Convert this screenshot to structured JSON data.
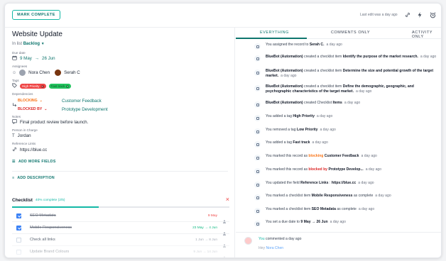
{
  "topbar": {
    "mark_complete_label": "MARK COMPLETE",
    "last_edited": "Last edit was a day ago",
    "icons": [
      "link-icon",
      "bolt-icon",
      "alarm-icon"
    ]
  },
  "record": {
    "title": "Website Update",
    "in_list_prefix": "In list",
    "list_name": "Backlog",
    "due_label": "Due date",
    "due_start": "9 May",
    "due_arrow": "→",
    "due_end": "26 Jun",
    "assignees_label": "Assignees",
    "assignees": [
      {
        "name": "Nora Chen"
      },
      {
        "name": "Serah C"
      }
    ],
    "tags_label": "Tags",
    "tags": [
      {
        "label": "High Priority",
        "color": "#ef4444"
      },
      {
        "label": "Fast track",
        "color": "#22c55e",
        "text_color": "#14532d"
      }
    ],
    "dependencies_label": "Dependencies",
    "dependencies": [
      {
        "kind": "BLOCKING",
        "color": "#f97316",
        "target": "Customer Feedback"
      },
      {
        "kind": "BLOCKED BY",
        "color": "#dc2626",
        "target": "Prototype Development"
      }
    ],
    "notes_label": "Notes",
    "notes": "Final product review before launch.",
    "person_label": "Person in Charge",
    "person": "Jordan",
    "reference_label": "Reference Links",
    "reference": "https://blue.cc",
    "add_more_fields": "ADD MORE FIELDS",
    "add_description": "ADD DESCRIPTION"
  },
  "checklist": {
    "title": "Checklist",
    "progress_text": "40% complete (2/5)",
    "progress": 0.4,
    "items": [
      {
        "label": "SEO Metadata",
        "done": true,
        "date": "9 May",
        "date_state": "over"
      },
      {
        "label": "Mobile Responsiveness",
        "done": true,
        "date": "23 May → 4 Jun",
        "date_state": "ok"
      },
      {
        "label": "Check all links",
        "done": false,
        "date": "1 Jun → 8 Jun",
        "date_state": "normal"
      },
      {
        "label": "Update Brand Colours",
        "done": false,
        "date": "9 Jun → 14 Jun",
        "date_state": "normal"
      }
    ]
  },
  "tabs": [
    {
      "label": "EVERYTHING",
      "active": true
    },
    {
      "label": "COMMENTS ONLY",
      "active": false
    },
    {
      "label": "ACTIVITY ONLY",
      "active": false
    }
  ],
  "activity": [
    {
      "icon": "assign-icon",
      "pre": "You assigned the record to ",
      "bold": "Serah C.",
      "post": "",
      "time": "a day ago"
    },
    {
      "icon": "checklist-icon",
      "pre": "",
      "bold": "BlueBot (Automation)",
      "post": " created a checklist item ",
      "bold2": "Identify the purpose of the market research.",
      "time": "a day ago"
    },
    {
      "icon": "checklist-icon",
      "pre": "",
      "bold": "BlueBot (Automation)",
      "post": " created a checklist item ",
      "bold2": "Determine the size and potential growth of the target market.",
      "time": "a day ago"
    },
    {
      "icon": "checklist-icon",
      "pre": "",
      "bold": "BlueBot (Automation)",
      "post": " created a checklist item ",
      "bold2": "Define the demographic, geographic, and psychographic characteristics of the target market.",
      "time": "a day ago"
    },
    {
      "icon": "checklist-icon",
      "pre": "",
      "bold": "BlueBot (Automation)",
      "post": " created Checklist ",
      "bold2": "Items",
      "time": "a day ago"
    },
    {
      "icon": "tag-icon",
      "pre": "You added a tag ",
      "bold": "High Priority",
      "post": "",
      "time": "a day ago"
    },
    {
      "icon": "tag-icon",
      "pre": "You removed a tag ",
      "bold": "Low Priority",
      "post": "",
      "time": "a day ago"
    },
    {
      "icon": "tag-icon",
      "pre": "You added a tag ",
      "bold": "Fast track",
      "post": "",
      "time": "a day ago"
    },
    {
      "icon": "dependency-icon",
      "pre": "You marked this record as ",
      "kw": "blocking",
      "kw_class": "orange",
      "bold": "Customer Feedback",
      "post": "",
      "time": "a day ago"
    },
    {
      "icon": "dependency-icon",
      "pre": "You marked this record as ",
      "kw": "blocked by",
      "kw_class": "red",
      "bold": "Prototype Develop...",
      "post": "",
      "time": "a day ago"
    },
    {
      "icon": "field-icon",
      "pre": "You updated the field ",
      "bold": "Reference Links",
      "post": " : ",
      "bold2": "https://blue.cc",
      "time": "a day ago"
    },
    {
      "icon": "checklist-icon",
      "pre": "You marked a checklist item ",
      "bold": "Mobile Responsiveness",
      "post": " as complete",
      "time": "a day ago"
    },
    {
      "icon": "checklist-icon",
      "pre": "You marked a checklist item ",
      "bold": "SEO Metadata",
      "post": " as complete",
      "time": "a day ago"
    },
    {
      "icon": "calendar-icon",
      "pre": "You set a due date to ",
      "bold": "9 May → 26 Jun",
      "post": "",
      "time": "a day ago"
    }
  ],
  "comment": {
    "author": "You",
    "action": " commented a day ago",
    "text_prefix": "Hey ",
    "mention": "Nora Chen"
  }
}
